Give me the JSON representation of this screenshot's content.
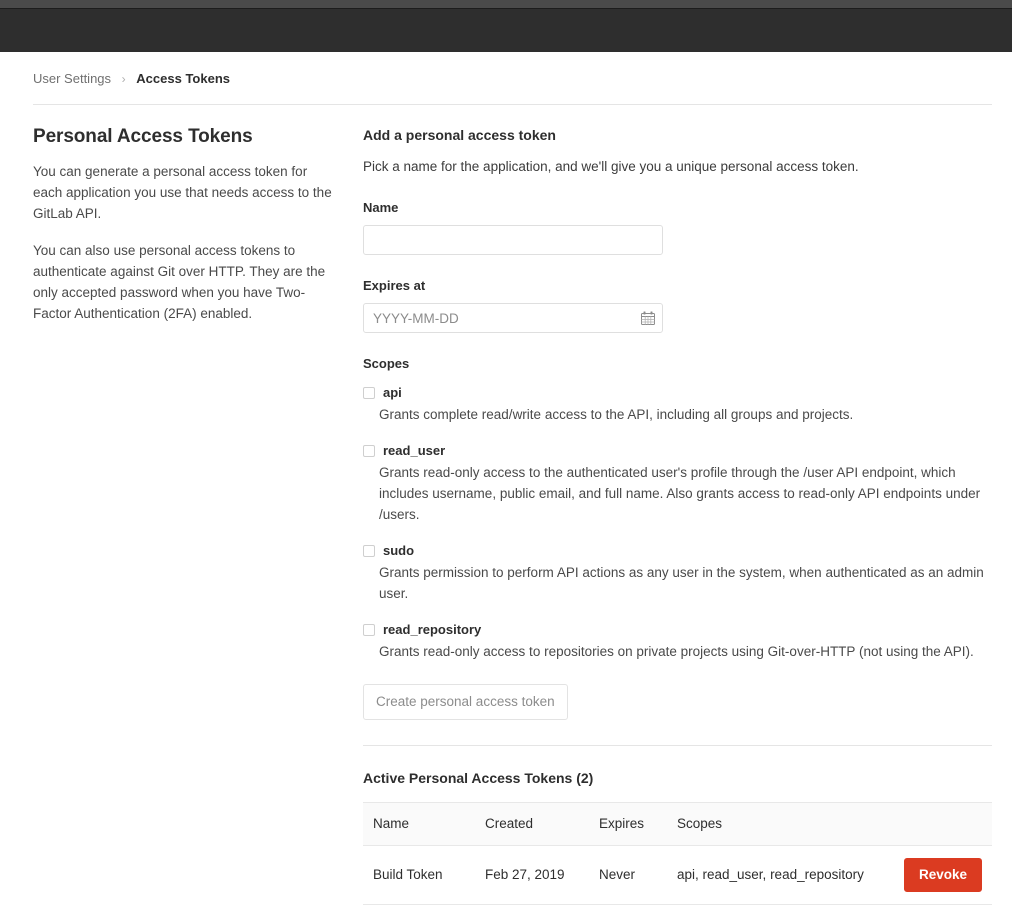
{
  "chrome": {
    "strip_color": "#4a4a4a",
    "navbar_color": "#2e2e2e"
  },
  "breadcrumb": {
    "parent": "User Settings",
    "separator": "›",
    "current": "Access Tokens"
  },
  "aside": {
    "title": "Personal Access Tokens",
    "paragraphs": [
      "You can generate a personal access token for each application you use that needs access to the GitLab API.",
      "You can also use personal access tokens to authenticate against Git over HTTP. They are the only accepted password when you have Two-Factor Authentication (2FA) enabled."
    ]
  },
  "form": {
    "title": "Add a personal access token",
    "intro": "Pick a name for the application, and we'll give you a unique personal access token.",
    "name_label": "Name",
    "name_value": "",
    "name_placeholder": "",
    "expires_label": "Expires at",
    "expires_value": "",
    "expires_placeholder": "YYYY-MM-DD",
    "calendar_icon": "calendar-icon",
    "scopes_label": "Scopes",
    "scopes": [
      {
        "name": "api",
        "checked": false,
        "description": "Grants complete read/write access to the API, including all groups and projects."
      },
      {
        "name": "read_user",
        "checked": false,
        "description": "Grants read-only access to the authenticated user's profile through the /user API endpoint, which includes username, public email, and full name. Also grants access to read-only API endpoints under /users."
      },
      {
        "name": "sudo",
        "checked": false,
        "description": "Grants permission to perform API actions as any user in the system, when authenticated as an admin user."
      },
      {
        "name": "read_repository",
        "checked": false,
        "description": "Grants read-only access to repositories on private projects using Git-over-HTTP (not using the API)."
      }
    ],
    "submit_label": "Create personal access token",
    "submit_disabled": true
  },
  "tokens": {
    "title": "Active Personal Access Tokens (2)",
    "count": 2,
    "columns": [
      "Name",
      "Created",
      "Expires",
      "Scopes",
      ""
    ],
    "rows": [
      {
        "name": "Build Token",
        "created": "Feb 27, 2019",
        "expires": "Never",
        "scopes": "api, read_user, read_repository",
        "action_label": "Revoke"
      }
    ],
    "revoke_color": "#db3b21"
  }
}
